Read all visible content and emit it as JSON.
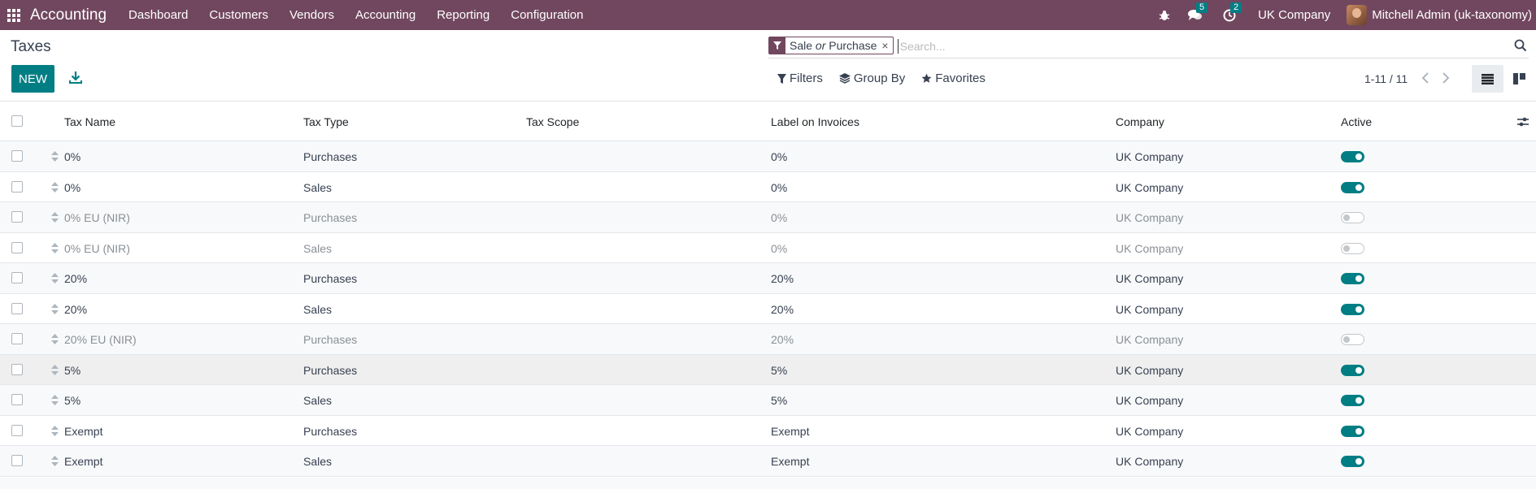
{
  "navbar": {
    "app_name": "Accounting",
    "menu": [
      "Dashboard",
      "Customers",
      "Vendors",
      "Accounting",
      "Reporting",
      "Configuration"
    ],
    "messages_count": "5",
    "activities_count": "2",
    "company": "UK Company",
    "user": "Mitchell Admin (uk-taxonomy)"
  },
  "control_panel": {
    "title": "Taxes",
    "new_label": "NEW",
    "facet_part1": "Sale",
    "facet_or": "or",
    "facet_part2": "Purchase",
    "facet_remove": "×",
    "search_placeholder": "Search...",
    "filters_label": "Filters",
    "groupby_label": "Group By",
    "favorites_label": "Favorites",
    "pager": "1-11 / 11"
  },
  "table": {
    "columns": [
      "Tax Name",
      "Tax Type",
      "Tax Scope",
      "Label on Invoices",
      "Company",
      "Active"
    ],
    "rows": [
      {
        "name": "0%",
        "type": "Purchases",
        "scope": "",
        "label": "0%",
        "company": "UK Company",
        "active": true
      },
      {
        "name": "0%",
        "type": "Sales",
        "scope": "",
        "label": "0%",
        "company": "UK Company",
        "active": true
      },
      {
        "name": "0% EU (NIR)",
        "type": "Purchases",
        "scope": "",
        "label": "0%",
        "company": "UK Company",
        "active": false
      },
      {
        "name": "0% EU (NIR)",
        "type": "Sales",
        "scope": "",
        "label": "0%",
        "company": "UK Company",
        "active": false
      },
      {
        "name": "20%",
        "type": "Purchases",
        "scope": "",
        "label": "20%",
        "company": "UK Company",
        "active": true
      },
      {
        "name": "20%",
        "type": "Sales",
        "scope": "",
        "label": "20%",
        "company": "UK Company",
        "active": true
      },
      {
        "name": "20% EU (NIR)",
        "type": "Purchases",
        "scope": "",
        "label": "20%",
        "company": "UK Company",
        "active": false
      },
      {
        "name": "5%",
        "type": "Purchases",
        "scope": "",
        "label": "5%",
        "company": "UK Company",
        "active": true
      },
      {
        "name": "5%",
        "type": "Sales",
        "scope": "",
        "label": "5%",
        "company": "UK Company",
        "active": true
      },
      {
        "name": "Exempt",
        "type": "Purchases",
        "scope": "",
        "label": "Exempt",
        "company": "UK Company",
        "active": true
      },
      {
        "name": "Exempt",
        "type": "Sales",
        "scope": "",
        "label": "Exempt",
        "company": "UK Company",
        "active": true
      }
    ]
  },
  "colors": {
    "navbar": "#71475f",
    "primary": "#017e84"
  }
}
